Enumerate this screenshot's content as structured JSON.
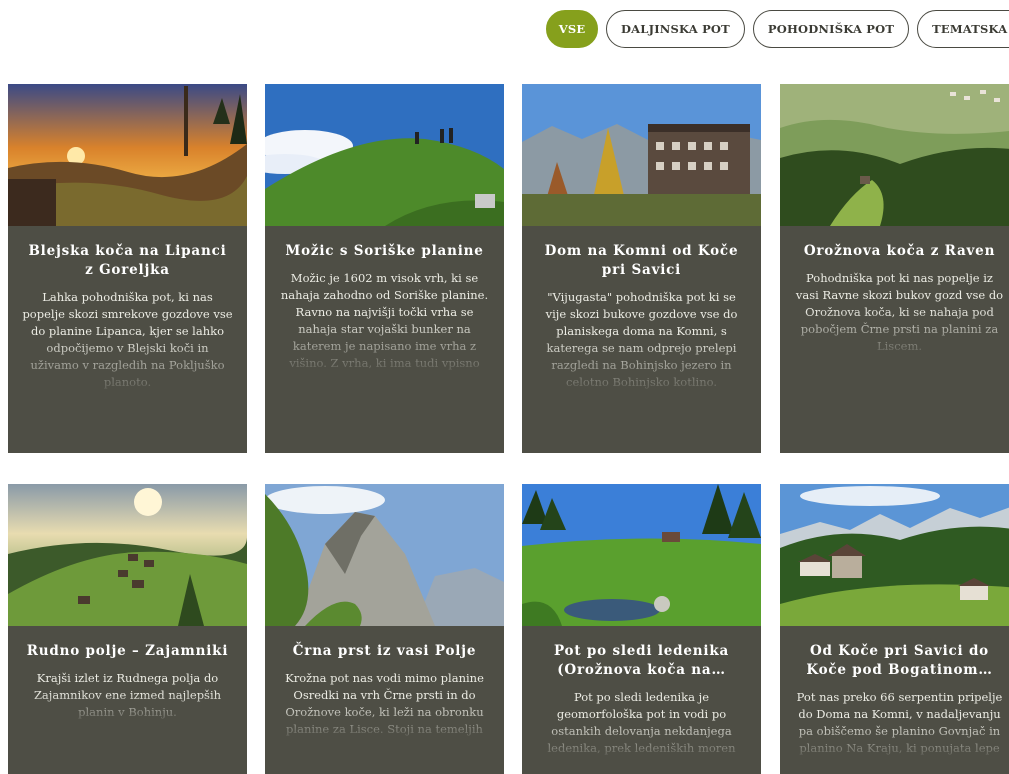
{
  "filters": [
    {
      "label": "VSE",
      "active": true
    },
    {
      "label": "DALJINSKA POT",
      "active": false
    },
    {
      "label": "POHODNIŠKA POT",
      "active": false
    },
    {
      "label": "TEMATSKA POT",
      "active": false
    }
  ],
  "colors": {
    "accent": "#86a01c",
    "card_bg": "#4e4e45",
    "chip_border": "#4a4a42"
  },
  "cards": [
    {
      "title": "Blejska koča na Lipanci z Goreljka",
      "description": "Lahka pohodniška pot, ki nas popelje skozi smrekove gozdove vse do planine Lipanca, kjer se lahko odpočijemo v Blejski koči in uživamo v razgledih na Pokljuško planoto.",
      "image": "sunset-mountain-meadow"
    },
    {
      "title": "Možic s Soriške planine",
      "description": "Možic je 1602 m visok vrh, ki se nahaja zahodno od Soriške planine. Ravno na najvišji točki vrha se nahaja star vojaški bunker na katerem je napisano ime vrha z višino. Z vrha, ki ima tudi vpisno",
      "image": "grassy-summit-hikers"
    },
    {
      "title": "Dom na Komni od Koče pri Savici",
      "description": "\"Vijugasta\" pohodniška pot ki se vije skozi bukove gozdove vse do planiskega doma na Komni, s katerega se nam odprejo prelepi razgledi na Bohinjsko jezero in celotno Bohinjsko kotlino.",
      "image": "mountain-hut-autumn"
    },
    {
      "title": "Orožnova koča z Raven",
      "description": "Pohodniška pot ki nas popelje iz vasi Ravne skozi bukov gozd vse do Orožnova koča, ki se nahaja pod pobočjem Črne prsti na planini za Liscem.",
      "image": "forest-valley-village"
    },
    {
      "title": "Rudno polje – Zajamniki",
      "description": "Krajši izlet iz Rudnega polja do Zajamnikov ene izmed najlepših planin v Bohinju.",
      "image": "alpine-pasture-huts"
    },
    {
      "title": "Črna prst iz vasi Polje",
      "description": "Krožna pot nas vodi mimo planine Osredki na vrh Črne prsti in do Orožnove koče, ki leži na obronku planine za Lisce. Stoji na temeljih",
      "image": "rocky-peak"
    },
    {
      "title": "Pot po sledi ledenika (Orožnova koča na…",
      "description": "Pot po sledi ledenika je geomorfološka pot in vodi po ostankih delovanja nekdanjega ledenika, prek ledeniških moren",
      "image": "meadow-pond"
    },
    {
      "title": "Od Koče pri Savici do Koče pod Bogatinom…",
      "description": "Pot nas preko 66 serpentin pripelje do Doma na Komni, v nadaljevanju pa obiščemo še planino Govnjač in planino Na Kraju, ki ponujata lepe",
      "image": "alpine-huts-peaks"
    }
  ]
}
